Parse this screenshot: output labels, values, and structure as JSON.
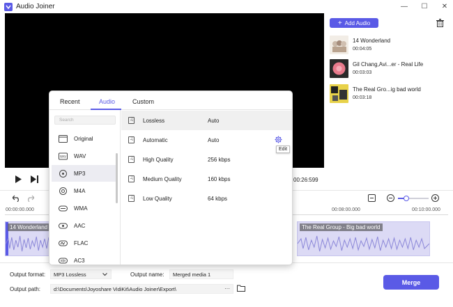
{
  "window": {
    "title": "Audio Joiner"
  },
  "sidebar": {
    "add_audio_label": "Add Audio",
    "tracks": [
      {
        "name": "14 Wonderland",
        "duration": "00:04:05"
      },
      {
        "name": "Gil Chang,Avi...er - Real Life",
        "duration": "00:03:03"
      },
      {
        "name": "The Real Gro...ig bad world",
        "duration": "00:03:18"
      }
    ]
  },
  "player": {
    "total_time": "00:26:599"
  },
  "ruler": {
    "ticks": [
      "00:00:00.000",
      "00:08:00.000",
      "00:10:00.000"
    ]
  },
  "timeline": {
    "clips": [
      {
        "label": "14 Wonderland"
      },
      {
        "label": "The Real Group - Big bad world"
      }
    ]
  },
  "zoom": {
    "level": 0.28
  },
  "output": {
    "format_label": "Output format:",
    "format_value": "MP3 Lossless",
    "name_label": "Output name:",
    "name_value": "Merged media 1",
    "path_label": "Output path:",
    "path_value": "d:\\Documents\\Joyoshare VidiKit\\Audio Joiner\\Export\\",
    "browse": "···",
    "merge_label": "Merge"
  },
  "format_popup": {
    "tabs": [
      "Recent",
      "Audio",
      "Custom"
    ],
    "active_tab": "Audio",
    "search_placeholder": "Search",
    "formats": [
      "Original",
      "WAV",
      "MP3",
      "M4A",
      "WMA",
      "AAC",
      "FLAC",
      "AC3"
    ],
    "selected_format": "MP3",
    "qualities": [
      {
        "name": "Lossless",
        "rate": "Auto"
      },
      {
        "name": "Automatic",
        "rate": "Auto"
      },
      {
        "name": "High Quality",
        "rate": "256 kbps"
      },
      {
        "name": "Medium Quality",
        "rate": "160 kbps"
      },
      {
        "name": "Low Quality",
        "rate": "64 kbps"
      }
    ],
    "edit_tooltip": "Edit"
  },
  "colors": {
    "accent": "#5a5ae6",
    "clip": "#dcdaf5"
  }
}
